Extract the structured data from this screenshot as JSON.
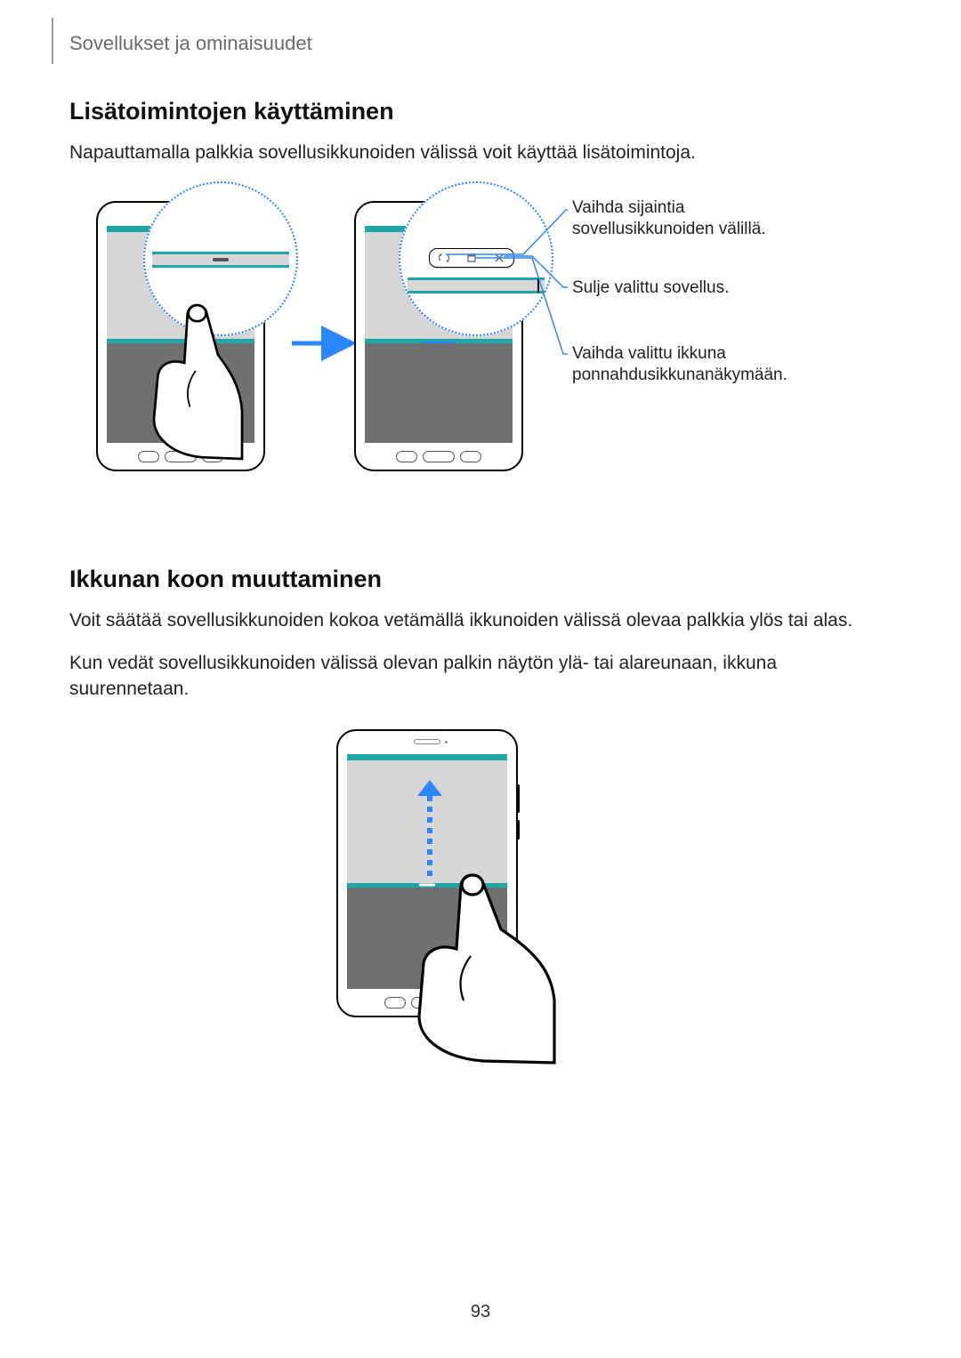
{
  "header": "Sovellukset ja ominaisuudet",
  "section1": {
    "heading": "Lisätoimintojen käyttäminen",
    "paragraph": "Napauttamalla palkkia sovellusikkunoiden välissä voit käyttää lisätoimintoja."
  },
  "callouts": {
    "swap": "Vaihda sijaintia sovellusikkunoiden välillä.",
    "close": "Sulje valittu sovellus.",
    "popup": "Vaihda valittu ikkuna ponnahdusikkunanäkymään."
  },
  "popover_icons": {
    "swap": "swap-icon",
    "popup": "rect-icon",
    "close": "close-icon"
  },
  "section2": {
    "heading": "Ikkunan koon muuttaminen",
    "paragraph1": "Voit säätää sovellusikkunoiden kokoa vetämällä ikkunoiden välissä olevaa palkkia ylös tai alas.",
    "paragraph2": "Kun vedät sovellusikkunoiden välissä olevan palkin näytön ylä- tai alareunaan, ikkuna suurennetaan."
  },
  "page_number": "93"
}
